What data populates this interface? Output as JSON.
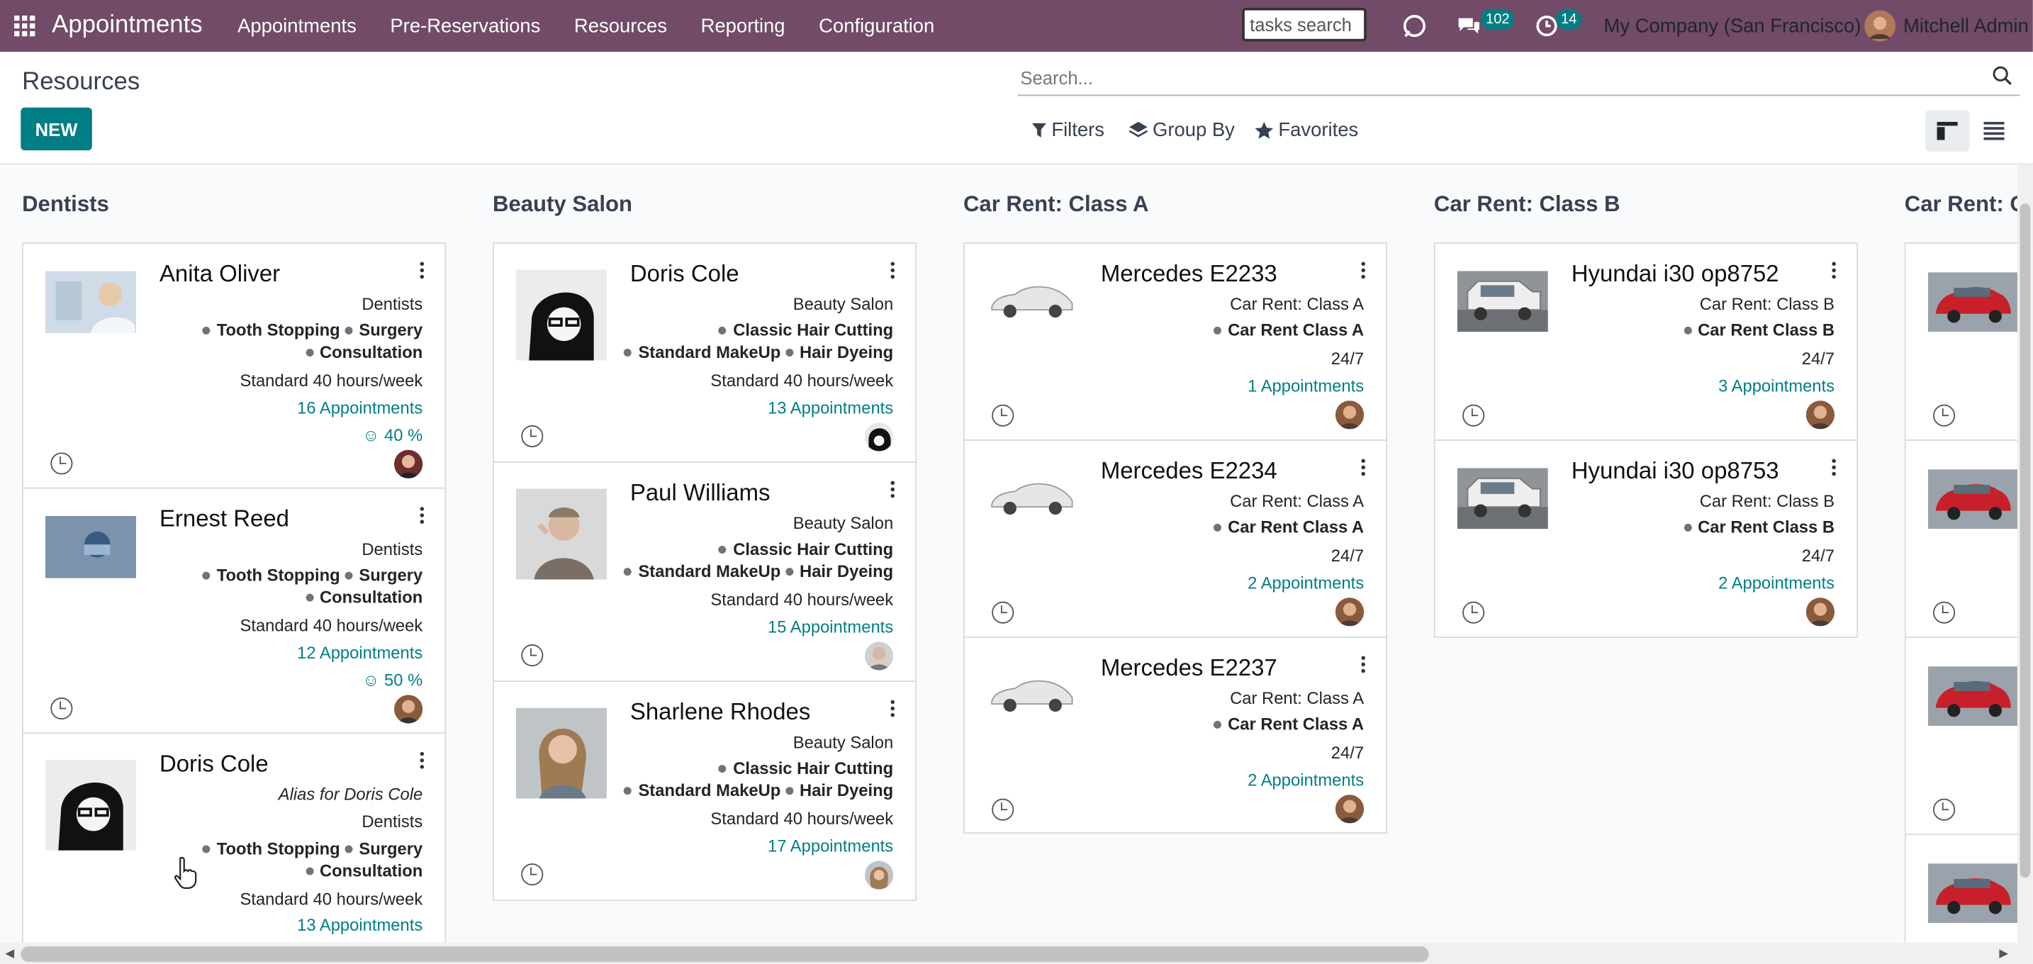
{
  "navbar": {
    "app_name": "Appointments",
    "menu": [
      "Appointments",
      "Pre-Reservations",
      "Resources",
      "Reporting",
      "Configuration"
    ],
    "tasks_search": "tasks search",
    "messages_count": "102",
    "activities_count": "14",
    "company": "My Company (San Francisco)",
    "user": "Mitchell Admin",
    "icons": [
      "apps-grid-icon",
      "refresh-icon",
      "chat-icon",
      "clock-icon"
    ]
  },
  "control": {
    "title": "Resources",
    "new_label": "NEW",
    "search_placeholder": "Search...",
    "filters": "Filters",
    "group_by": "Group By",
    "favorites": "Favorites",
    "views": [
      "kanban-view-icon",
      "list-view-icon"
    ],
    "active_view": "kanban"
  },
  "columns": [
    {
      "title": "Dentists",
      "cards": [
        {
          "name": "Anita Oliver",
          "category": "Dentists",
          "tags": [
            "Tooth Stopping",
            "Surgery",
            "Consultation"
          ],
          "schedule": "Standard 40 hours/week",
          "appointments": "16 Appointments",
          "satisfaction": "40 %"
        },
        {
          "name": "Ernest Reed",
          "category": "Dentists",
          "tags": [
            "Tooth Stopping",
            "Surgery",
            "Consultation"
          ],
          "schedule": "Standard 40 hours/week",
          "appointments": "12 Appointments",
          "satisfaction": "50 %"
        },
        {
          "name": "Doris Cole",
          "alias": "Alias for Doris Cole",
          "category": "Dentists",
          "tags": [
            "Tooth Stopping",
            "Surgery",
            "Consultation"
          ],
          "schedule": "Standard 40 hours/week",
          "appointments": "13 Appointments"
        }
      ]
    },
    {
      "title": "Beauty Salon",
      "cards": [
        {
          "name": "Doris Cole",
          "category": "Beauty Salon",
          "tags": [
            "Classic Hair Cutting",
            "Standard MakeUp",
            "Hair Dyeing"
          ],
          "schedule": "Standard 40 hours/week",
          "appointments": "13 Appointments"
        },
        {
          "name": "Paul Williams",
          "category": "Beauty Salon",
          "tags": [
            "Classic Hair Cutting",
            "Standard MakeUp",
            "Hair Dyeing"
          ],
          "schedule": "Standard 40 hours/week",
          "appointments": "15 Appointments"
        },
        {
          "name": "Sharlene Rhodes",
          "category": "Beauty Salon",
          "tags": [
            "Classic Hair Cutting",
            "Standard MakeUp",
            "Hair Dyeing"
          ],
          "schedule": "Standard 40 hours/week",
          "appointments": "17 Appointments"
        }
      ]
    },
    {
      "title": "Car Rent: Class A",
      "cards": [
        {
          "name": "Mercedes E2233",
          "category": "Car Rent: Class A",
          "tag": "Car Rent Class A",
          "schedule": "24/7",
          "appointments": "1 Appointments"
        },
        {
          "name": "Mercedes E2234",
          "category": "Car Rent: Class A",
          "tag": "Car Rent Class A",
          "schedule": "24/7",
          "appointments": "2 Appointments"
        },
        {
          "name": "Mercedes E2237",
          "category": "Car Rent: Class A",
          "tag": "Car Rent Class A",
          "schedule": "24/7",
          "appointments": "2 Appointments"
        }
      ]
    },
    {
      "title": "Car Rent: Class B",
      "cards": [
        {
          "name": "Hyundai i30 op8752",
          "category": "Car Rent: Class B",
          "tag": "Car Rent Class B",
          "schedule": "24/7",
          "appointments": "3 Appointments"
        },
        {
          "name": "Hyundai i30 op8753",
          "category": "Car Rent: Class B",
          "tag": "Car Rent Class B",
          "schedule": "24/7",
          "appointments": "2 Appointments"
        }
      ]
    },
    {
      "title": "Car Rent: C"
    }
  ],
  "colors": {
    "navbar": "#714b67",
    "primary": "#017e84",
    "link": "#017e84"
  }
}
